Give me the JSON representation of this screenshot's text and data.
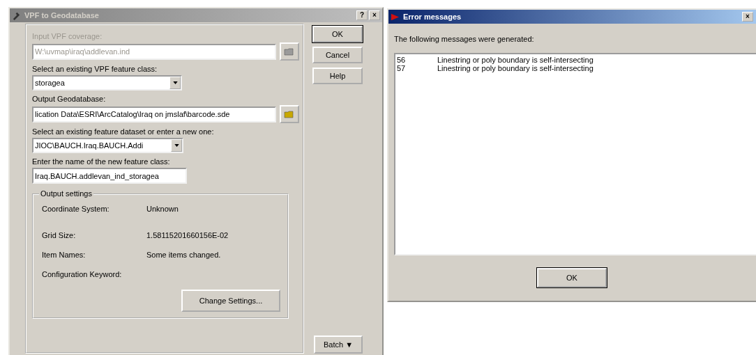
{
  "main_window": {
    "title": "VPF to Geodatabase",
    "active": false,
    "input_coverage": {
      "label": "Input VPF coverage:",
      "value": "W:\\uvmap\\iraq\\addlevan.ind",
      "disabled": true
    },
    "feature_class": {
      "label": "Select an existing VPF feature class:",
      "value": "storagea"
    },
    "output_geodatabase": {
      "label": "Output Geodatabase:",
      "value": "lication Data\\ESRI\\ArcCatalog\\Iraq on jmslaf\\barcode.sde",
      "disabled": false
    },
    "feature_dataset": {
      "label": "Select an existing feature dataset or enter a new one:",
      "value": "JIOC\\BAUCH.Iraq.BAUCH.Addi"
    },
    "new_feature_class": {
      "label": "Enter the name of the new feature class:",
      "value": "Iraq.BAUCH.addlevan_ind_storagea"
    },
    "output_settings": {
      "title": "Output settings",
      "rows": [
        {
          "label": "Coordinate System:",
          "value": "Unknown"
        },
        {
          "label": "Grid Size:",
          "value": "1.58115201660156E-02"
        },
        {
          "label": "Item Names:",
          "value": "Some items changed."
        },
        {
          "label": "Configuration Keyword:",
          "value": ""
        }
      ],
      "button": "Change Settings..."
    },
    "buttons": [
      "OK",
      "Cancel",
      "Help"
    ],
    "batch_button": "Batch ▼",
    "title_buttons": [
      "?",
      "×"
    ]
  },
  "error_window": {
    "title": "Error messages",
    "active": true,
    "intro": "The following messages were generated:",
    "messages": [
      {
        "code": "56",
        "text": "Linestring or poly boundary is self-intersecting"
      },
      {
        "code": "57",
        "text": "Linestring or poly boundary is self-intersecting"
      }
    ],
    "ok_button": "OK",
    "close_button": "×"
  }
}
